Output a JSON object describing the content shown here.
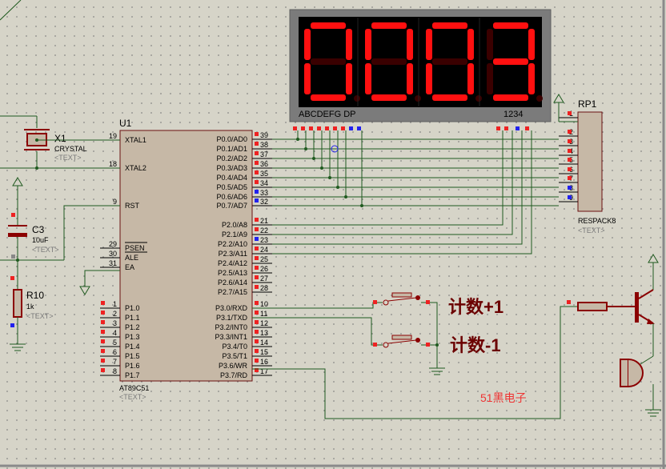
{
  "display": {
    "digits": [
      "0",
      "0",
      "0",
      "3"
    ],
    "segment_label": "ABCDEFG  DP",
    "digit_label": "1234"
  },
  "u1": {
    "ref": "U1",
    "part": "AT89C51",
    "text": "<TEXT>",
    "left_pins": [
      {
        "num": "19",
        "name": "XTAL1"
      },
      {
        "num": "18",
        "name": "XTAL2"
      },
      {
        "num": "9",
        "name": "RST"
      },
      {
        "num": "29",
        "name": "PSEN"
      },
      {
        "num": "30",
        "name": "ALE"
      },
      {
        "num": "31",
        "name": "EA"
      },
      {
        "num": "1",
        "name": "P1.0"
      },
      {
        "num": "2",
        "name": "P1.1"
      },
      {
        "num": "3",
        "name": "P1.2"
      },
      {
        "num": "4",
        "name": "P1.3"
      },
      {
        "num": "5",
        "name": "P1.4"
      },
      {
        "num": "6",
        "name": "P1.5"
      },
      {
        "num": "7",
        "name": "P1.6"
      },
      {
        "num": "8",
        "name": "P1.7"
      }
    ],
    "right_pins": [
      {
        "num": "39",
        "name": "P0.0/AD0"
      },
      {
        "num": "38",
        "name": "P0.1/AD1"
      },
      {
        "num": "37",
        "name": "P0.2/AD2"
      },
      {
        "num": "36",
        "name": "P0.3/AD3"
      },
      {
        "num": "35",
        "name": "P0.4/AD4"
      },
      {
        "num": "34",
        "name": "P0.5/AD5"
      },
      {
        "num": "33",
        "name": "P0.6/AD6"
      },
      {
        "num": "32",
        "name": "P0.7/AD7"
      },
      {
        "num": "21",
        "name": "P2.0/A8"
      },
      {
        "num": "22",
        "name": "P2.1/A9"
      },
      {
        "num": "23",
        "name": "P2.2/A10"
      },
      {
        "num": "24",
        "name": "P2.3/A11"
      },
      {
        "num": "25",
        "name": "P2.4/A12"
      },
      {
        "num": "26",
        "name": "P2.5/A13"
      },
      {
        "num": "27",
        "name": "P2.6/A14"
      },
      {
        "num": "28",
        "name": "P2.7/A15"
      },
      {
        "num": "10",
        "name": "P3.0/RXD"
      },
      {
        "num": "11",
        "name": "P3.1/TXD"
      },
      {
        "num": "12",
        "name": "P3.2/INT0"
      },
      {
        "num": "13",
        "name": "P3.3/INT1"
      },
      {
        "num": "14",
        "name": "P3.4/T0"
      },
      {
        "num": "15",
        "name": "P3.5/T1"
      },
      {
        "num": "16",
        "name": "P3.6/WR"
      },
      {
        "num": "17",
        "name": "P3.7/RD"
      }
    ]
  },
  "rp1": {
    "ref": "RP1",
    "part": "RESPACK8",
    "text": "<TEXT>",
    "pins": [
      "1",
      "2",
      "3",
      "4",
      "5",
      "6",
      "7",
      "8",
      "9"
    ]
  },
  "x1": {
    "ref": "X1",
    "part": "CRYSTAL",
    "text": "<TEXT>"
  },
  "c3": {
    "ref": "C3",
    "value": "10uF",
    "text": "<TEXT>"
  },
  "r10": {
    "ref": "R10",
    "value": "1k",
    "text": "<TEXT>"
  },
  "buttons": {
    "plus_label": "计数+1",
    "minus_label": "计数-1"
  },
  "watermark": "51黑电子",
  "colors": {
    "wire": "#1f5a1f",
    "component": "#8b0000",
    "body": "#c6b8a6",
    "display_on": "#ff1010",
    "display_off": "#3a0000",
    "pin_red": "#ee2222",
    "pin_blue": "#2222ee",
    "text_gray": "#7a7a7a"
  }
}
